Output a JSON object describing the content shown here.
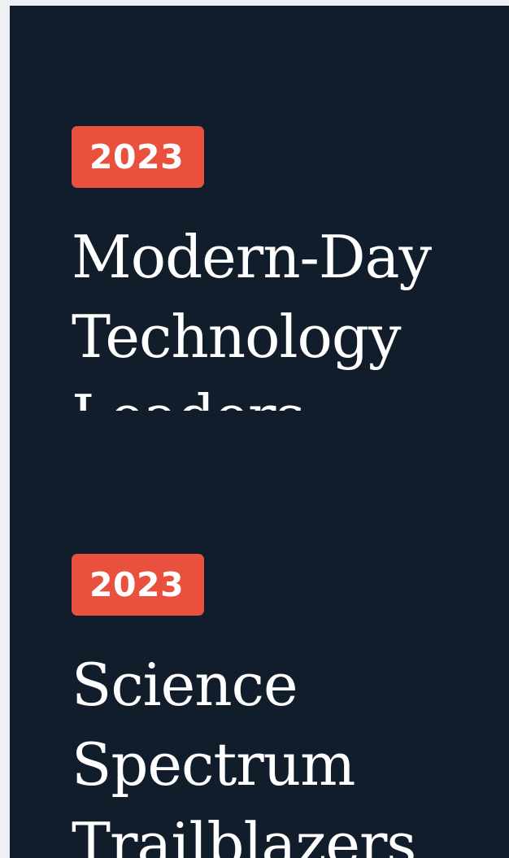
{
  "articles": [
    {
      "year": "2023",
      "title": "Modern-Day\nTechnology\nLeaders"
    },
    {
      "year": "2023",
      "title": "Science\nSpectrum\nTrailblazers"
    }
  ],
  "colors": {
    "page_background": "#eef1f3",
    "panel_background": "#121d2b",
    "badge_background": "#e9503d",
    "text": "#ffffff"
  }
}
